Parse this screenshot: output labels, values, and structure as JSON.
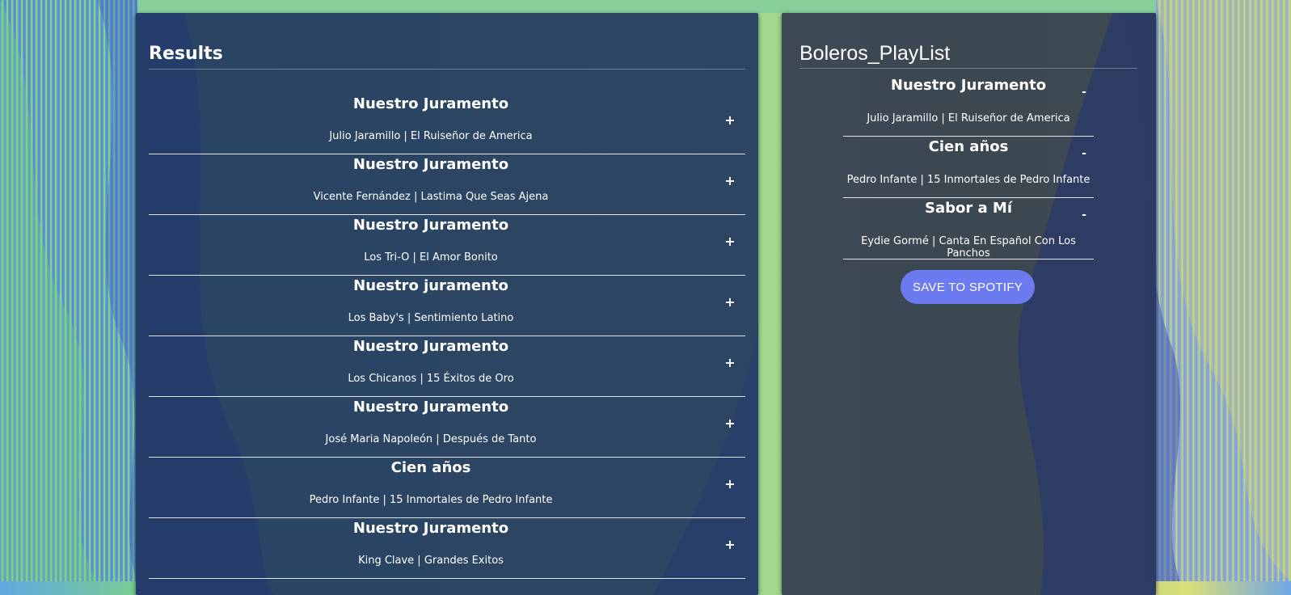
{
  "results": {
    "title": "Results",
    "add_symbol": "+",
    "tracks": [
      {
        "name": "Nuestro Juramento",
        "info": "Julio Jaramillo | El Ruiseñor de America"
      },
      {
        "name": "Nuestro Juramento",
        "info": "Vicente Fernández | Lastima Que Seas Ajena"
      },
      {
        "name": "Nuestro Juramento",
        "info": "Los Tri-O | El Amor Bonito"
      },
      {
        "name": "Nuestro juramento",
        "info": "Los Baby's | Sentimiento Latino"
      },
      {
        "name": "Nuestro Juramento",
        "info": "Los Chicanos | 15 Éxitos de Oro"
      },
      {
        "name": "Nuestro Juramento",
        "info": "José Maria Napoleón | Después de Tanto"
      },
      {
        "name": "Cien años",
        "info": "Pedro Infante | 15 Inmortales de Pedro Infante"
      },
      {
        "name": "Nuestro Juramento",
        "info": "King Clave | Grandes Exitos"
      }
    ]
  },
  "playlist": {
    "title": "Boleros_PlayList",
    "remove_symbol": "-",
    "tracks": [
      {
        "name": "Nuestro Juramento",
        "info": "Julio Jaramillo | El Ruiseñor de America"
      },
      {
        "name": "Cien años",
        "info": "Pedro Infante | 15 Inmortales de Pedro Infante"
      },
      {
        "name": "Sabor a Mí",
        "info": "Eydie Gormé | Canta En Español Con Los Panchos"
      }
    ],
    "save_label": "SAVE TO SPOTIFY"
  },
  "colors": {
    "save_button": "#6c7af0",
    "results_panel": "#223a60",
    "playlist_panel": "#374250"
  }
}
